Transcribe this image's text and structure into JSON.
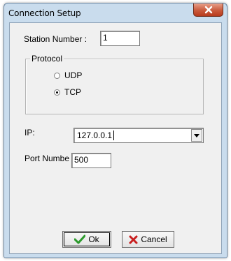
{
  "window": {
    "title": "Connection Setup",
    "close_icon": "close-icon"
  },
  "station": {
    "label": "Station Number :",
    "value": "1"
  },
  "protocol": {
    "legend": "Protocol",
    "options": [
      {
        "label": "UDP",
        "selected": false
      },
      {
        "label": "TCP",
        "selected": true
      }
    ]
  },
  "ip": {
    "label": "IP:",
    "value": "127.0.0.1"
  },
  "port": {
    "label": "Port Numbe",
    "value": "500"
  },
  "buttons": {
    "ok_label": "Ok",
    "cancel_label": "Cancel"
  },
  "colors": {
    "ok_check": "#2c9a2c",
    "cancel_x": "#c81e1e",
    "close_button": "#c95a3c"
  }
}
